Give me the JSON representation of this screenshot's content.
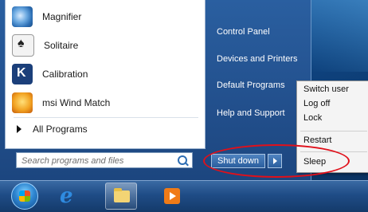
{
  "programs": [
    {
      "label": "Magnifier",
      "icon": "magnifier-icon"
    },
    {
      "label": "Solitaire",
      "icon": "solitaire-icon"
    },
    {
      "label": "Calibration",
      "icon": "calibration-icon"
    },
    {
      "label": "msi Wind Match",
      "icon": "msi-wind-match-icon"
    }
  ],
  "all_programs": "All Programs",
  "search": {
    "placeholder": "Search programs and files"
  },
  "right_pane": [
    "Control Panel",
    "Devices and Printers",
    "Default Programs",
    "Help and Support"
  ],
  "shutdown": {
    "label": "Shut down"
  },
  "submenu": [
    "Switch user",
    "Log off",
    "Lock",
    "Restart",
    "Sleep"
  ],
  "colors": {
    "highlight_oval": "#e0101a"
  }
}
